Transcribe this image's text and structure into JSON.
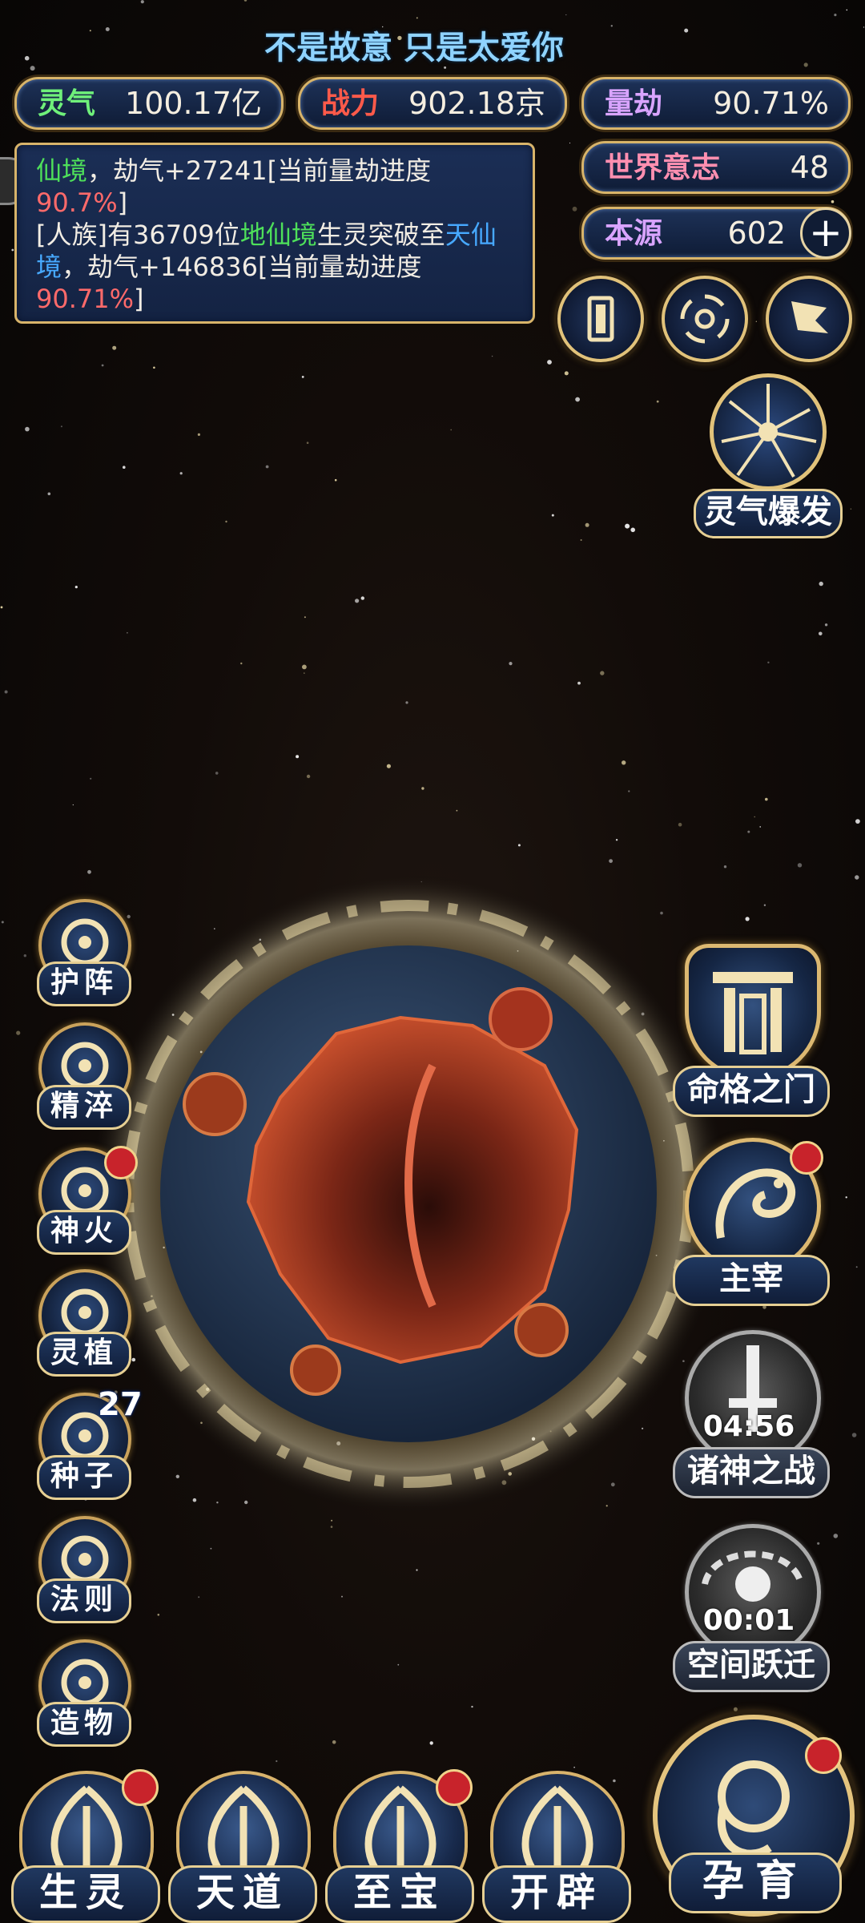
{
  "marquee": "不是故意 只是太爱你",
  "stats": {
    "lingqi": {
      "label": "灵气",
      "value": "100.17亿",
      "color": "#6ff07a"
    },
    "zhanli": {
      "label": "战力",
      "value": "902.18京",
      "color": "#ff5a4a"
    },
    "liangjie": {
      "label": "量劫",
      "value": "90.71%",
      "color": "#d9a4ff"
    },
    "shijie_yizhi": {
      "label": "世界意志",
      "value": "48",
      "color": "#ff8fb0"
    },
    "benyuan": {
      "label": "本源",
      "value": "602",
      "color": "#d9a4ff",
      "plus": "+"
    }
  },
  "log": {
    "line1_a": "仙境",
    "line1_b": "，劫气+27241[当前量劫进度",
    "line1_c": "90.7%",
    "line1_d": "]",
    "line2_a": "[人族]有36709位",
    "line2_b": "地仙境",
    "line2_c": "生灵突破至",
    "line2_d": "天仙境",
    "line2_e": "，劫气+146836[当前量劫进度",
    "line2_f": "90.71%",
    "line2_g": "]"
  },
  "top_icons": [
    {
      "name": "card-icon"
    },
    {
      "name": "vortex-icon"
    },
    {
      "name": "flag-icon"
    }
  ],
  "burst": {
    "label": "灵气爆发"
  },
  "left_features": [
    {
      "label": "护阵",
      "icon": "yin-yang-icon",
      "dot": false,
      "badge": ""
    },
    {
      "label": "精淬",
      "icon": "lotus-flame-icon",
      "dot": false,
      "badge": ""
    },
    {
      "label": "神火",
      "icon": "fire-icon",
      "dot": true,
      "badge": ""
    },
    {
      "label": "灵植",
      "icon": "plant-icon",
      "dot": false,
      "badge": ""
    },
    {
      "label": "种子",
      "icon": "seed-icon",
      "dot": false,
      "badge": "27"
    },
    {
      "label": "法则",
      "icon": "law-icon",
      "dot": false,
      "badge": ""
    },
    {
      "label": "造物",
      "icon": "creation-icon",
      "dot": false,
      "badge": ""
    }
  ],
  "right_features": {
    "minggemen": {
      "label": "命格之门"
    },
    "zhuzai": {
      "label": "主宰"
    },
    "zhushen": {
      "label": "诸神之战",
      "timer": "04:56"
    },
    "kongjian": {
      "label": "空间跃迁",
      "timer": "00:01"
    }
  },
  "bottom_nav": [
    {
      "label": "生灵",
      "dot": true
    },
    {
      "label": "天道",
      "dot": false
    },
    {
      "label": "至宝",
      "dot": true
    },
    {
      "label": "开辟",
      "dot": false
    }
  ],
  "yunyu": {
    "label": "孕育",
    "dot": true
  },
  "colors": {
    "gold": "#d8b46a",
    "panel": "#1b2e55",
    "planet": "#a8321f"
  }
}
